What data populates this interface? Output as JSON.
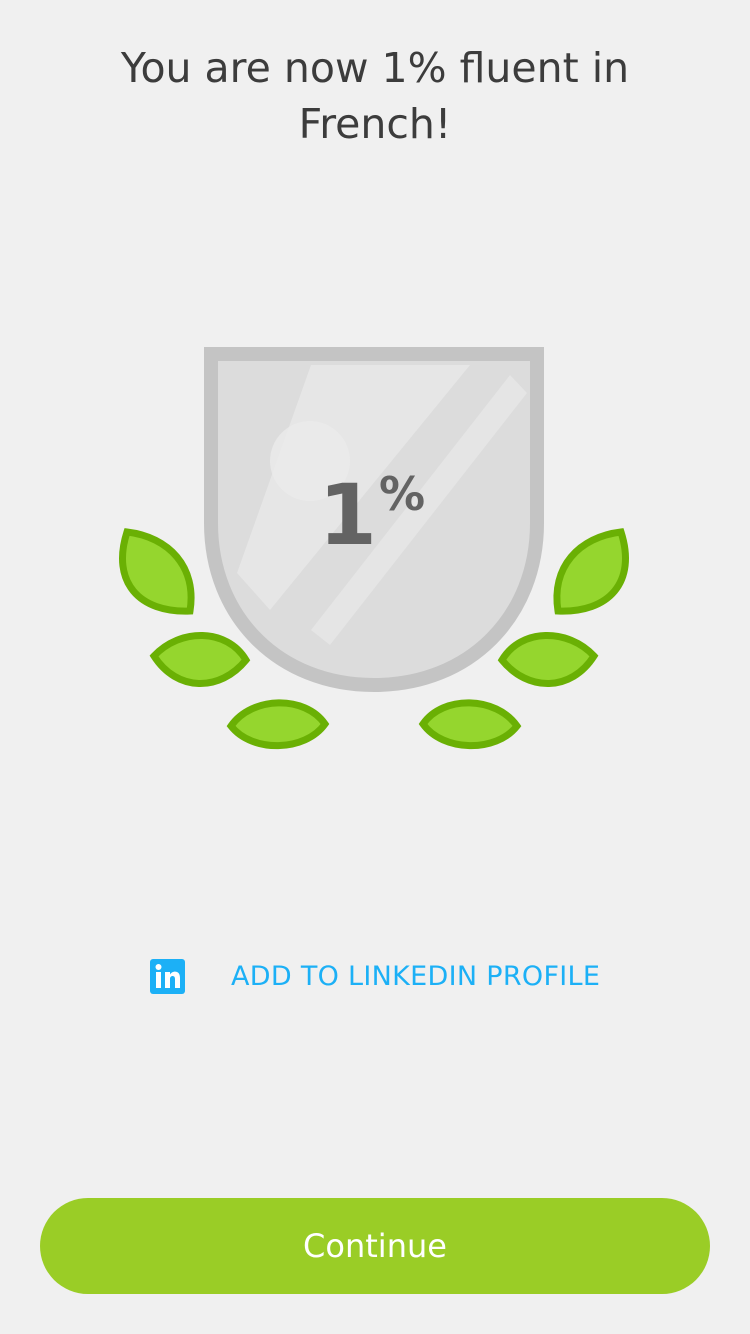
{
  "header": {
    "title": "You are now 1% fluent in French!"
  },
  "badge": {
    "number": "1",
    "percent_sign": "%",
    "progress_percent": 1,
    "icon": "shield-laurel-icon",
    "colors": {
      "shield_fill": "#dcdcdc",
      "shield_border": "#c4c4c4",
      "number": "#636363",
      "leaf_fill": "#95d62e",
      "leaf_border": "#6ab004"
    }
  },
  "linkedin": {
    "icon": "linkedin-icon",
    "icon_text": "in",
    "label": "ADD TO LINKEDIN PROFILE",
    "color": "#1cb0f6"
  },
  "footer": {
    "continue_label": "Continue",
    "button_color": "#9acd26"
  }
}
